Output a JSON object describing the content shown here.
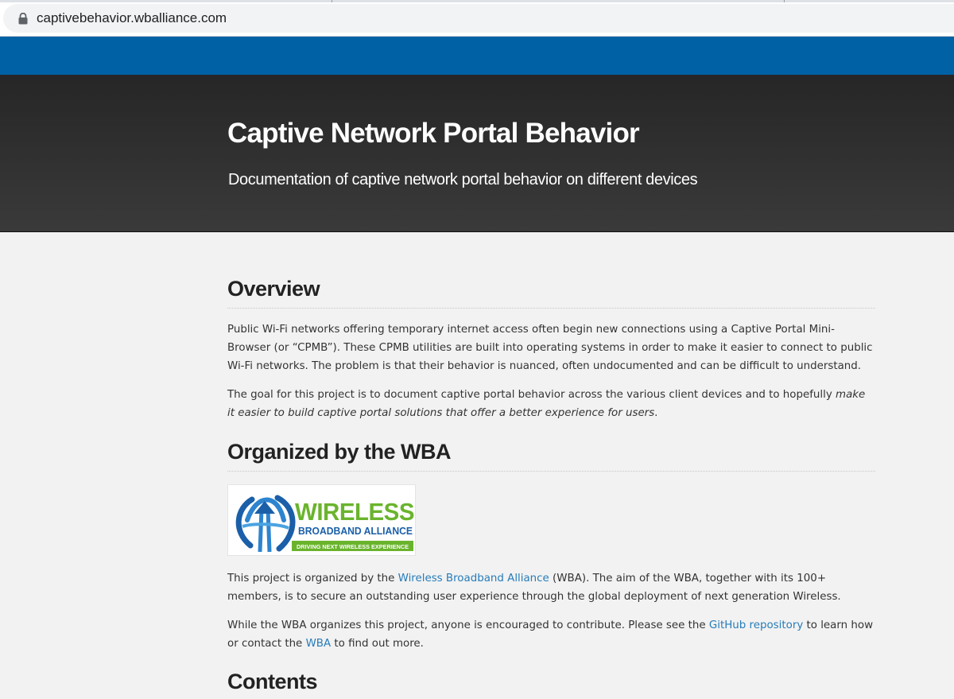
{
  "browser": {
    "url": "captivebehavior.wballiance.com"
  },
  "header": {
    "title": "Captive Network Portal Behavior",
    "subtitle": "Documentation of captive network portal behavior on different devices"
  },
  "overview": {
    "heading": "Overview",
    "intro": "Public Wi-Fi networks offering temporary internet access often begin new connections using a Captive Portal Mini-Browser (or “CPMB”). These CPMB utilities are built into operating systems in order to make it easier to connect to public Wi-Fi networks. The problem is that their behavior is nuanced, often undocumented and can be difficult to understand.",
    "goal_start": "The goal for this project is to document captive portal behavior across the various client devices and to hopefully ",
    "goal_em": "make it easier to build captive portal solutions that offer a better experience for users",
    "goal_end": "."
  },
  "organized": {
    "heading": "Organized by the WBA",
    "logo": {
      "line1": "WIRELESS",
      "line2": "BROADBAND ALLIANCE",
      "tagline": "DRIVING NEXT WIRELESS EXPERIENCE",
      "green": "#6ab42d",
      "blue": "#1a5fa8"
    },
    "p1_start": "This project is organized by the ",
    "p1_link": "Wireless Broadband Alliance",
    "p1_end": " (WBA). The aim of the WBA, together with its 100+ members, is to secure an outstanding user experience through the global deployment of next generation Wireless.",
    "p2_start": "While the WBA organizes this project, anyone is encouraged to contribute. Please see the ",
    "p2_link1": "GitHub repository",
    "p2_mid": " to learn how or contact the ",
    "p2_link2": "WBA",
    "p2_end": " to find out more."
  },
  "contents": {
    "heading": "Contents"
  },
  "colors": {
    "blue_bar": "#0061a4",
    "link": "#267cb9",
    "header_bg": "#2e2e2e"
  }
}
